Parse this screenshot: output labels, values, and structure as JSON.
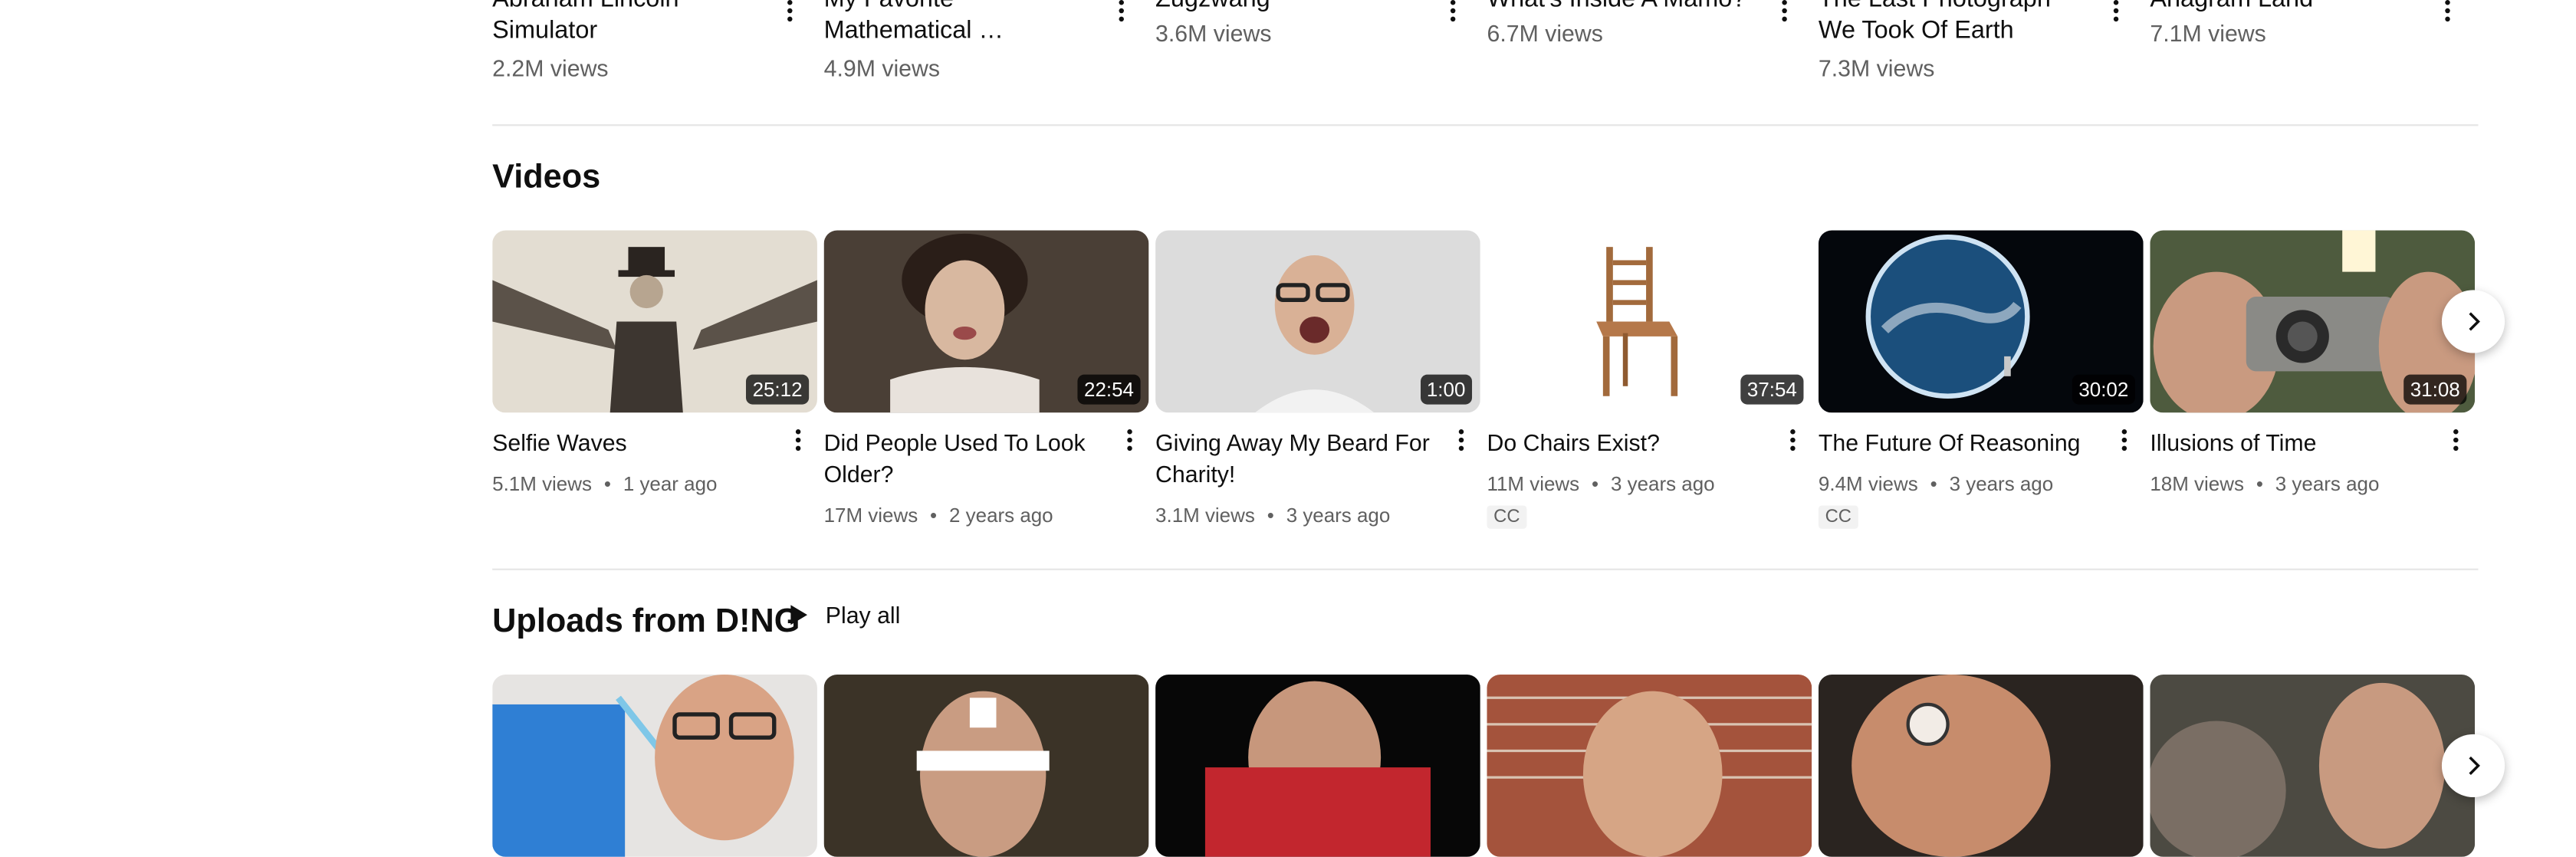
{
  "top_row": [
    {
      "title": "Abraham Lincoln Simulator",
      "title_line1": "Abraham Lincoln",
      "title_line2": "Simulator",
      "views": "2.2M views"
    },
    {
      "title": "My Favorite Mathematical …",
      "title_line1": "My Favorite",
      "title_line2": "Mathematical …",
      "views": "4.9M views"
    },
    {
      "title": "Zugzwang",
      "title_line1": "Zugzwang",
      "title_line2": "",
      "views": "3.6M views"
    },
    {
      "title": "What's Inside A Mamo?",
      "title_line1": "What's Inside A Mamo?",
      "title_line2": "",
      "views": "6.7M views"
    },
    {
      "title": "The Last Photograph We Took Of Earth",
      "title_line1": "The Last Photograph",
      "title_line2": "We Took Of Earth",
      "views": "7.3M views"
    },
    {
      "title": "Anagram Land",
      "title_line1": "Anagram Land",
      "title_line2": "",
      "views": "7.1M views"
    }
  ],
  "videos_section": {
    "heading": "Videos",
    "items": [
      {
        "title": "Selfie Waves",
        "views": "5.1M views",
        "age": "1 year ago",
        "duration": "25:12",
        "cc": ""
      },
      {
        "title": "Did People Used To Look Older?",
        "views": "17M views",
        "age": "2 years ago",
        "duration": "22:54",
        "cc": ""
      },
      {
        "title": "Giving Away My Beard For Charity!",
        "views": "3.1M views",
        "age": "3 years ago",
        "duration": "1:00",
        "cc": ""
      },
      {
        "title": "Do Chairs Exist?",
        "views": "11M views",
        "age": "3 years ago",
        "duration": "37:54",
        "cc": "CC"
      },
      {
        "title": "The Future Of Reasoning",
        "views": "9.4M views",
        "age": "3 years ago",
        "duration": "30:02",
        "cc": "CC"
      },
      {
        "title": "Illusions of Time",
        "views": "18M views",
        "age": "3 years ago",
        "duration": "31:08",
        "cc": ""
      }
    ]
  },
  "uploads_section": {
    "heading": "Uploads from D!NG",
    "play_all": "Play all"
  },
  "meta_separator": "•",
  "icons": {
    "more": "vertical-dots-icon",
    "next": "chevron-right-icon",
    "play": "play-icon"
  }
}
